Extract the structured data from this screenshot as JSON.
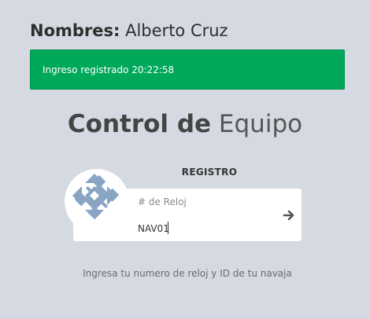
{
  "user": {
    "label": "Nombres:",
    "name": "Alberto Cruz"
  },
  "alert": {
    "message": "Ingreso registrado 20:22:58",
    "color": "#00a85a"
  },
  "title": {
    "bold": "Control de",
    "light": "Equipo"
  },
  "form": {
    "section_label": "REGISTRO",
    "field_label": "# de Reloj",
    "field_value": "NAV01",
    "submit_icon": "arrow-right-icon",
    "avatar_icon": "identicon-avatar"
  },
  "hint": "Ingresa tu numero de reloj y ID de tu navaja"
}
